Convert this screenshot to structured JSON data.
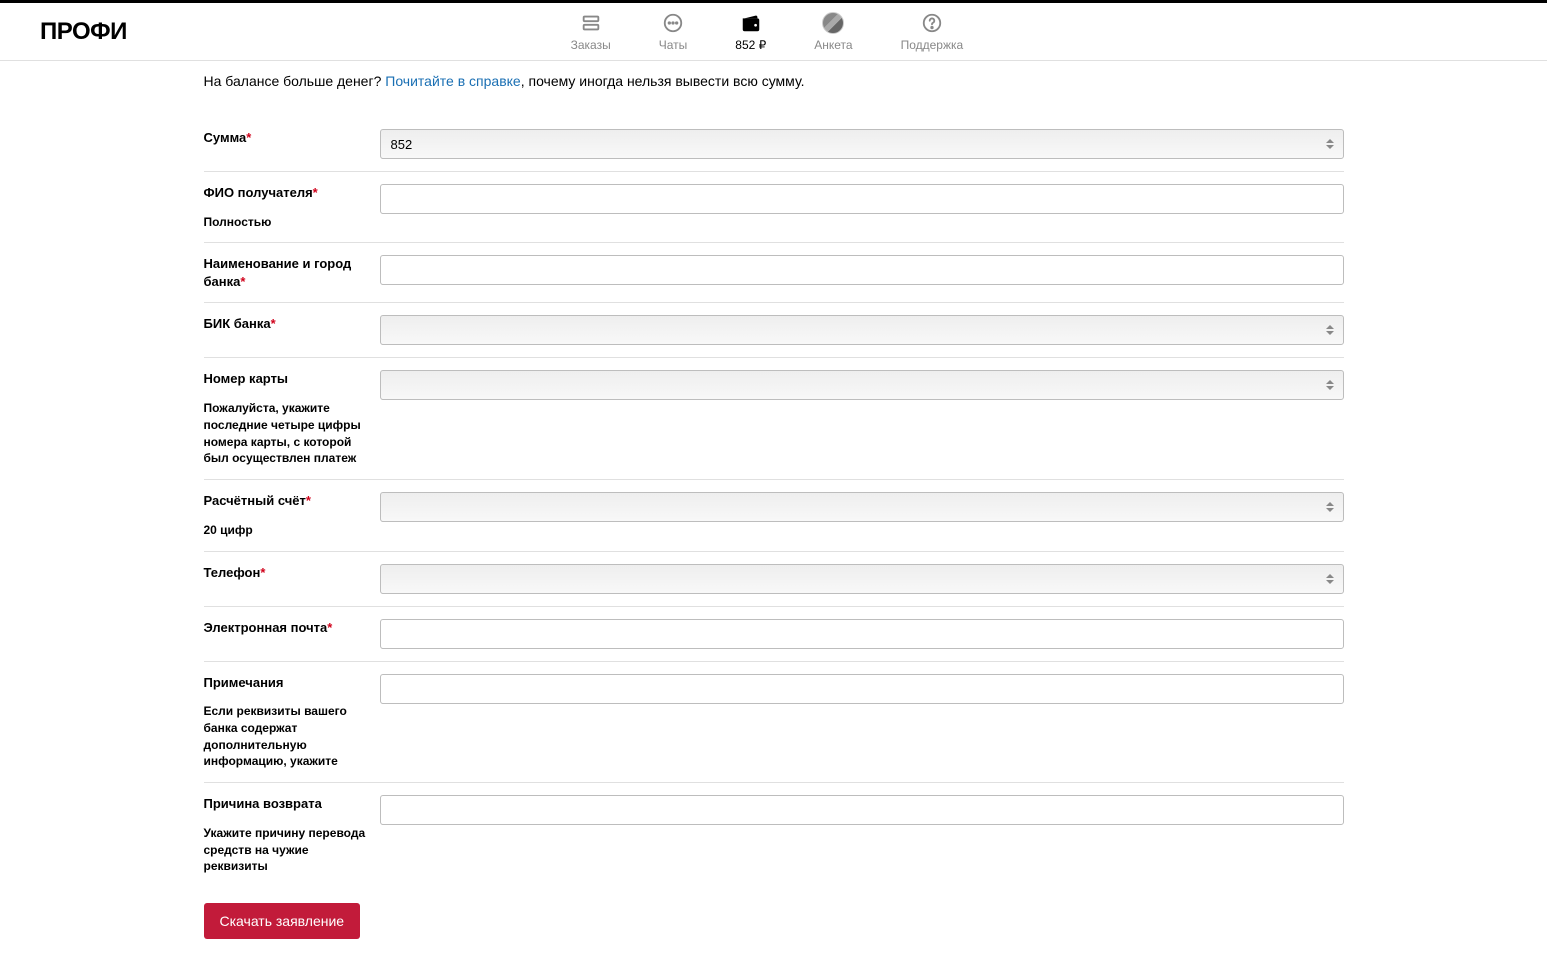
{
  "logo": "ПРОФИ",
  "nav": {
    "orders": "Заказы",
    "chats": "Чаты",
    "balance": "852 ₽",
    "profile": "Анкета",
    "support": "Поддержка"
  },
  "hint": {
    "prefix": "На балансе больше денег? ",
    "link": "Почитайте в справке",
    "suffix": ", почему иногда нельзя вывести всю сумму."
  },
  "fields": {
    "amount": {
      "label": "Сумма",
      "value": "852"
    },
    "fio": {
      "label": "ФИО получателя",
      "hint": "Полностью",
      "value": ""
    },
    "bank": {
      "label": "Наименование и город банка",
      "value": ""
    },
    "bik": {
      "label": "БИК банка",
      "value": ""
    },
    "card": {
      "label": "Номер карты",
      "hint": "Пожалуйста, укажите последние четыре цифры номера карты, с которой был осуществлен платеж",
      "value": ""
    },
    "account": {
      "label": "Расчётный счёт",
      "hint": "20 цифр",
      "value": ""
    },
    "phone": {
      "label": "Телефон",
      "value": ""
    },
    "email": {
      "label": "Электронная почта",
      "value": ""
    },
    "notes": {
      "label": "Примечания",
      "hint": "Если реквизиты вашего банка содержат дополнительную информацию, укажите",
      "value": ""
    },
    "reason": {
      "label": "Причина возврата",
      "hint": "Укажите причину перевода средств на чужие реквизиты",
      "value": ""
    }
  },
  "submit": "Скачать заявление"
}
